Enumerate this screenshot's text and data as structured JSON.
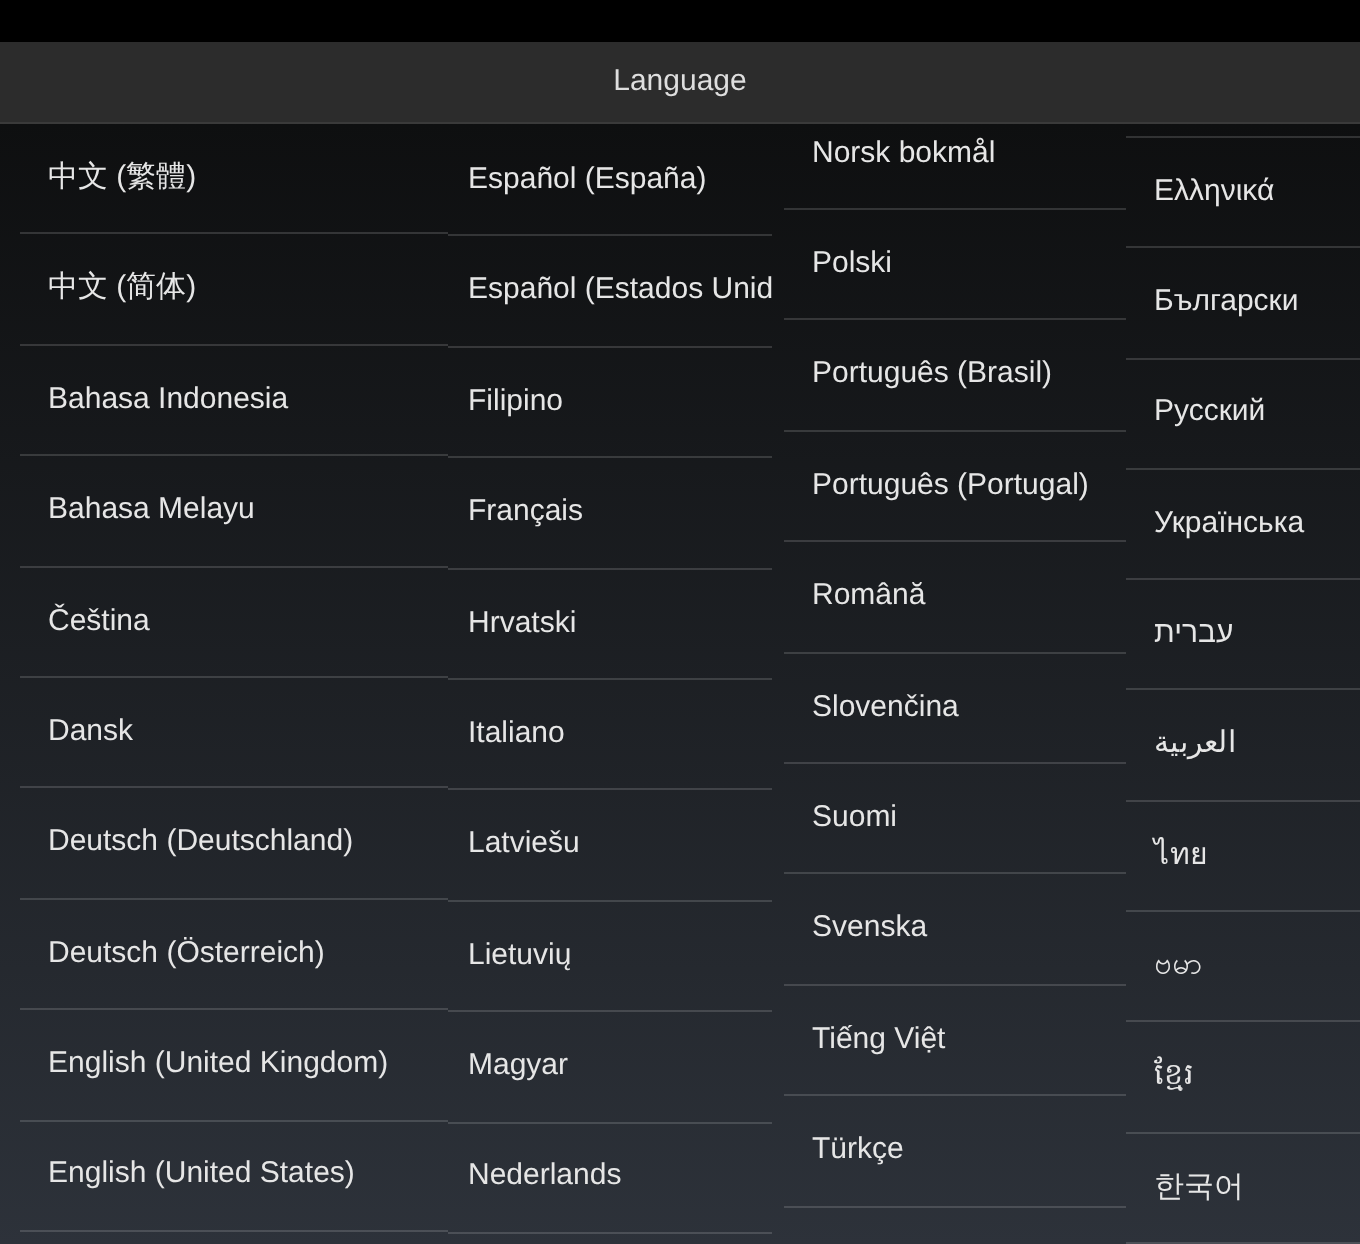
{
  "title_bar": {
    "title": "Language"
  },
  "language_list": {
    "columns": [
      [
        "中文 (繁體)",
        "中文 (简体)",
        "Bahasa Indonesia",
        "Bahasa Melayu",
        "Čeština",
        "Dansk",
        "Deutsch (Deutschland)",
        "Deutsch (Österreich)",
        "English (United Kingdom)",
        "English (United States)"
      ],
      [
        "Español (España)",
        "Español (Estados Unid",
        "Filipino",
        "Français",
        "Hrvatski",
        "Italiano",
        "Latviešu",
        "Lietuvių",
        "Magyar",
        "Nederlands"
      ],
      [
        "Norsk bokmål",
        "Polski",
        "Português (Brasil)",
        "Português (Portugal)",
        "Română",
        "Slovenčina",
        "Suomi",
        "Svenska",
        "Tiếng Việt",
        "Türkçe"
      ],
      [
        "Ελληνικά",
        "Български",
        "Русский",
        "Українська",
        "עברית",
        "العربية",
        "ไทย",
        "ဗမာ",
        "ខ្មែរ",
        "한국어"
      ]
    ]
  }
}
